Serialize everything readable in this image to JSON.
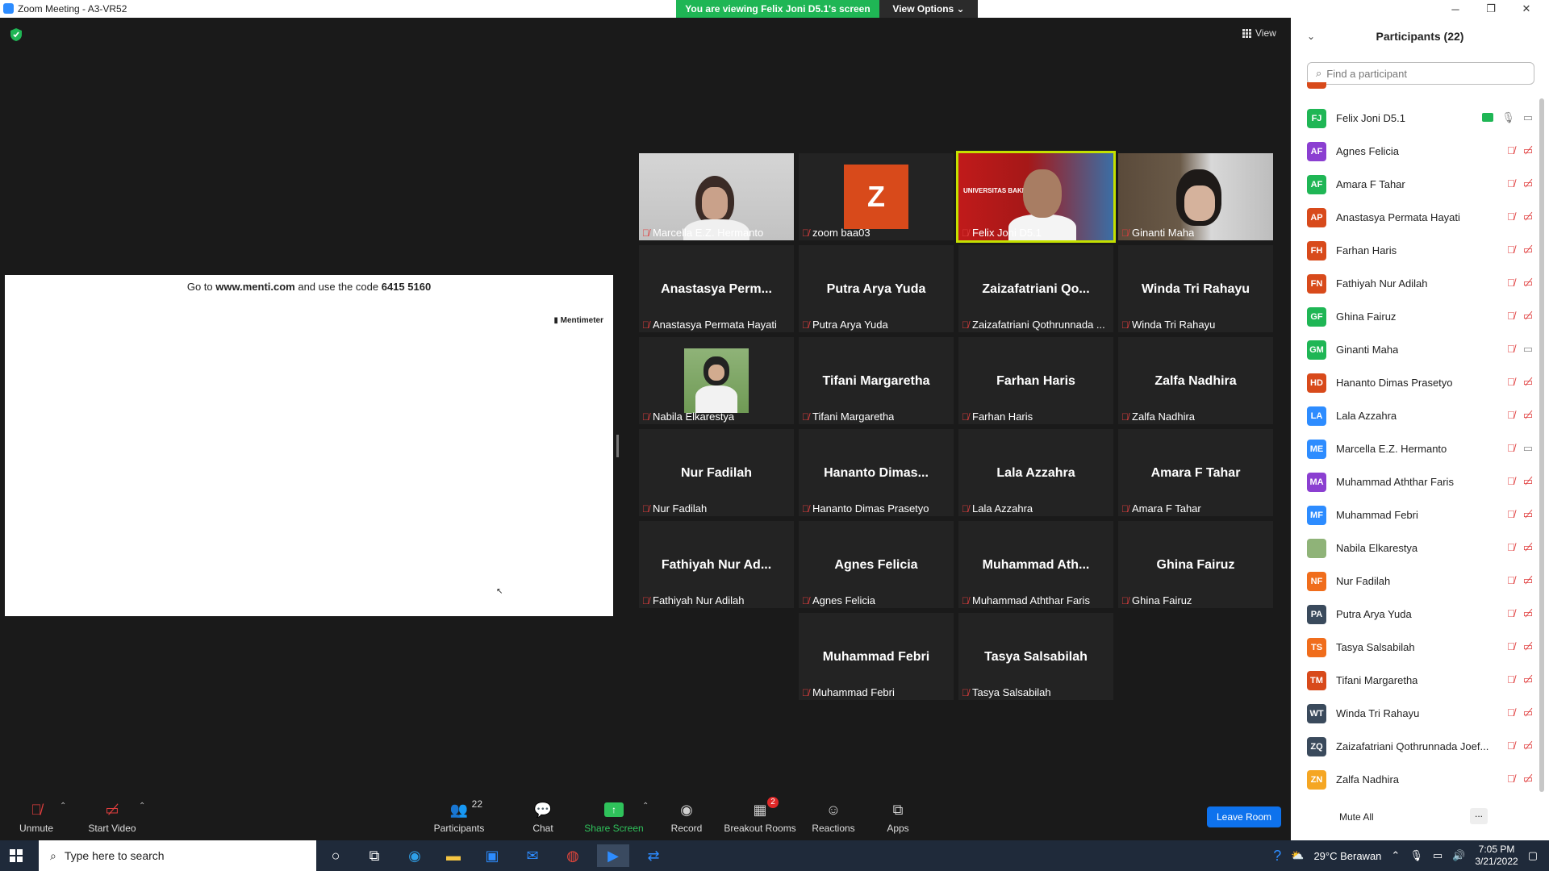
{
  "window": {
    "title": "Zoom Meeting - A3-VR52",
    "viewing_banner": "You are viewing Felix Joni D5.1's screen",
    "view_options": "View Options ⌄",
    "view_label": "View",
    "minimize": "─",
    "restore": "❐",
    "close": "✕"
  },
  "share": {
    "menti_prefix": "Go to ",
    "menti_url": "www.menti.com",
    "menti_mid": " and use the code ",
    "menti_code": "6415 5160",
    "menti_logo": "Mentimeter"
  },
  "tiles": [
    {
      "label": "Marcella E.Z. Hermanto",
      "kind": "video-person1"
    },
    {
      "label": "zoom baa03",
      "kind": "avatar-z",
      "avatar": "Z"
    },
    {
      "label": "Felix Joni D5.1",
      "kind": "video-felix",
      "overlay": "UNIVERSITAS BAKRIE"
    },
    {
      "label": "Ginanti Maha",
      "kind": "video-ginanti"
    },
    {
      "center": "Anastasya Perm...",
      "label": "Anastasya Permata Hayati"
    },
    {
      "center": "Putra Arya Yuda",
      "label": "Putra Arya Yuda"
    },
    {
      "center": "Zaizafatriani  Qo...",
      "label": "Zaizafatriani Qothrunnada ..."
    },
    {
      "center": "Winda Tri Rahayu",
      "label": "Winda Tri Rahayu"
    },
    {
      "label": "Nabila Elkarestya",
      "kind": "photo-nabila"
    },
    {
      "center": "Tifani Margaretha",
      "label": "Tifani Margaretha"
    },
    {
      "center": "Farhan Haris",
      "label": "Farhan Haris"
    },
    {
      "center": "Zalfa Nadhira",
      "label": "Zalfa Nadhira"
    },
    {
      "center": "Nur Fadilah",
      "label": "Nur Fadilah"
    },
    {
      "center": "Hananto  Dimas...",
      "label": "Hananto Dimas Prasetyo"
    },
    {
      "center": "Lala Azzahra",
      "label": "Lala Azzahra"
    },
    {
      "center": "Amara F Tahar",
      "label": "Amara F Tahar"
    },
    {
      "center": "Fathiyah  Nur  Ad...",
      "label": "Fathiyah Nur Adilah"
    },
    {
      "center": "Agnes Felicia",
      "label": "Agnes Felicia"
    },
    {
      "center": "Muhammad  Ath...",
      "label": "Muhammad Aththar Faris"
    },
    {
      "center": "Ghina Fairuz",
      "label": "Ghina Fairuz"
    },
    {
      "center": "Muhammad Febri",
      "label": "Muhammad Febri"
    },
    {
      "center": "Tasya Salsabilah",
      "label": "Tasya Salsabilah"
    }
  ],
  "toolbar": {
    "unmute": "Unmute",
    "start_video": "Start Video",
    "participants": "Participants",
    "participants_count": "22",
    "chat": "Chat",
    "share_screen": "Share Screen",
    "record": "Record",
    "breakout_rooms": "Breakout Rooms",
    "breakout_badge": "2",
    "reactions": "Reactions",
    "apps": "Apps",
    "leave_room": "Leave Room"
  },
  "panel": {
    "title": "Participants (22)",
    "search_placeholder": "Find a participant",
    "mute_all": "Mute All",
    "more": "...",
    "participants": [
      {
        "initials": "FJ",
        "name": "Felix Joni D5.1",
        "color": "#1fb655",
        "sharing": true,
        "mic": "on",
        "video": "on"
      },
      {
        "initials": "AF",
        "name": "Agnes Felicia",
        "color": "#8b3fd1",
        "mic": "off",
        "video": "off"
      },
      {
        "initials": "AF",
        "name": "Amara F Tahar",
        "color": "#1fb655",
        "mic": "off",
        "video": "off"
      },
      {
        "initials": "AP",
        "name": "Anastasya Permata Hayati",
        "color": "#d84a1b",
        "mic": "off",
        "video": "off"
      },
      {
        "initials": "FH",
        "name": "Farhan Haris",
        "color": "#d84a1b",
        "mic": "off",
        "video": "off"
      },
      {
        "initials": "FN",
        "name": "Fathiyah Nur Adilah",
        "color": "#d84a1b",
        "mic": "off",
        "video": "off"
      },
      {
        "initials": "GF",
        "name": "Ghina Fairuz",
        "color": "#1fb655",
        "mic": "off",
        "video": "off"
      },
      {
        "initials": "GM",
        "name": "Ginanti Maha",
        "color": "#1fb655",
        "mic": "off",
        "video": "on"
      },
      {
        "initials": "HD",
        "name": "Hananto Dimas Prasetyo",
        "color": "#d84a1b",
        "mic": "off",
        "video": "off"
      },
      {
        "initials": "LA",
        "name": "Lala Azzahra",
        "color": "#2d8cff",
        "mic": "off",
        "video": "off"
      },
      {
        "initials": "ME",
        "name": "Marcella E.Z. Hermanto",
        "color": "#2d8cff",
        "mic": "off",
        "video": "on"
      },
      {
        "initials": "MA",
        "name": "Muhammad Aththar Faris",
        "color": "#8b3fd1",
        "mic": "off",
        "video": "off"
      },
      {
        "initials": "MF",
        "name": "Muhammad Febri",
        "color": "#2d8cff",
        "mic": "off",
        "video": "off"
      },
      {
        "initials": "",
        "name": "Nabila Elkarestya",
        "color": "#8fb378",
        "photo": true,
        "mic": "off",
        "video": "off"
      },
      {
        "initials": "NF",
        "name": "Nur Fadilah",
        "color": "#f06d1c",
        "mic": "off",
        "video": "off"
      },
      {
        "initials": "PA",
        "name": "Putra Arya Yuda",
        "color": "#3a4a5c",
        "mic": "off",
        "video": "off"
      },
      {
        "initials": "TS",
        "name": "Tasya Salsabilah",
        "color": "#f06d1c",
        "mic": "off",
        "video": "off"
      },
      {
        "initials": "TM",
        "name": "Tifani Margaretha",
        "color": "#d84a1b",
        "mic": "off",
        "video": "off"
      },
      {
        "initials": "WT",
        "name": "Winda Tri Rahayu",
        "color": "#3a4a5c",
        "mic": "off",
        "video": "off"
      },
      {
        "initials": "ZQ",
        "name": "Zaizafatriani Qothrunnada Joef...",
        "color": "#3a4a5c",
        "mic": "off",
        "video": "off"
      },
      {
        "initials": "ZN",
        "name": "Zalfa Nadhira",
        "color": "#f5a623",
        "mic": "off",
        "video": "off"
      }
    ]
  },
  "taskbar": {
    "search_placeholder": "Type here to search",
    "weather": "29°C  Berawan",
    "time": "7:05 PM",
    "date": "3/21/2022"
  }
}
